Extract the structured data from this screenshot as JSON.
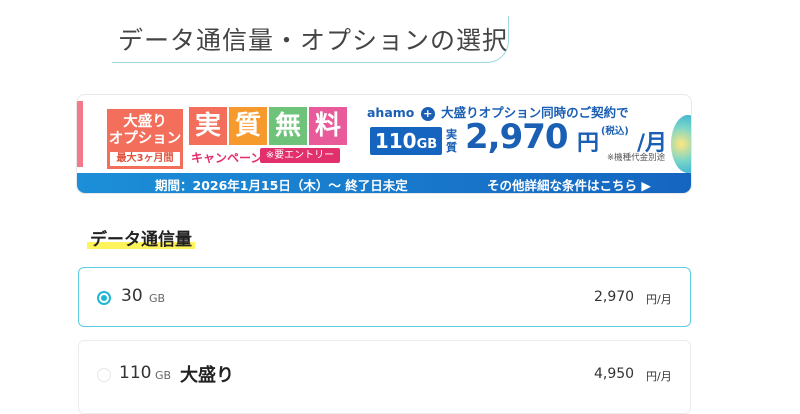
{
  "section_title": "データ通信量・オプションの選択",
  "banner": {
    "orange_line1": "大盛り",
    "orange_line2": "オプション",
    "orange_sub": "最大3ヶ月間",
    "kanji": [
      "実",
      "質",
      "無",
      "料"
    ],
    "kanji_colors": [
      "#f36f5b",
      "#f79a2e",
      "#6fc27a",
      "#e95a9a"
    ],
    "campaign": "キャンペーン",
    "entry": "※要エントリー",
    "ahamo_prefix": "ahamo",
    "ahamo_plus": "+",
    "ahamo_suffix": "大盛りオプション同時のご契約で",
    "gb_value": "110",
    "gb_unit": "GB",
    "jisshitsu": "実質",
    "price": "2,970",
    "price_unit": "円",
    "tax": "(税込)",
    "per_month": "/月",
    "note": "※機種代金別途",
    "period": "期間：2026年1月15日（木）〜 終了日未定",
    "details": "その他詳細な条件はこちら ▶"
  },
  "data_section": {
    "heading": "データ通信量",
    "options": [
      {
        "amount": "30",
        "unit": "GB",
        "label": "",
        "price": "2,970",
        "price_unit": "円/月",
        "selected": true
      },
      {
        "amount": "110",
        "unit": "GB",
        "label": "大盛り",
        "price": "4,950",
        "price_unit": "円/月",
        "selected": false
      }
    ]
  }
}
